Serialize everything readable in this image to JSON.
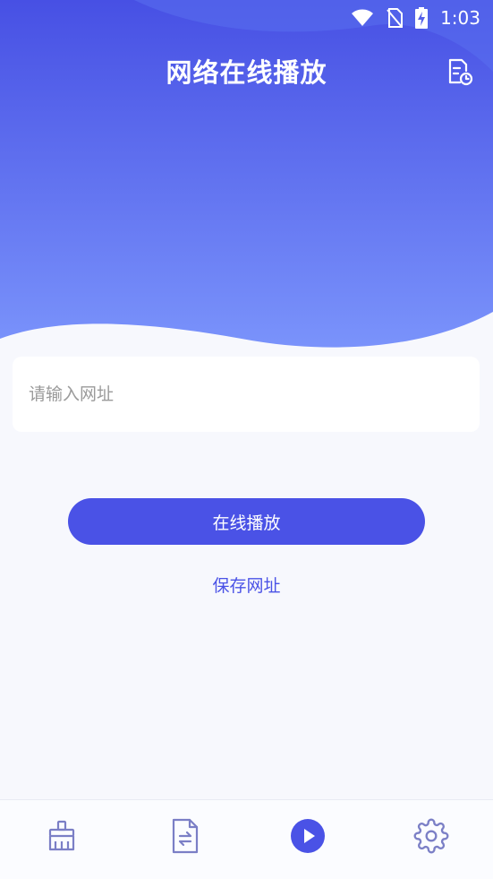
{
  "status_bar": {
    "time": "1:03"
  },
  "header": {
    "title": "网络在线播放",
    "history_icon": "history-document-icon"
  },
  "form": {
    "url_placeholder": "请输入网址",
    "url_value": "",
    "play_label": "在线播放",
    "save_label": "保存网址"
  },
  "bottom_nav": {
    "items": [
      {
        "id": "clean",
        "icon": "broom-icon",
        "active": false
      },
      {
        "id": "files",
        "icon": "document-transfer-icon",
        "active": false
      },
      {
        "id": "play",
        "icon": "play-circle-icon",
        "active": true
      },
      {
        "id": "settings",
        "icon": "gear-icon",
        "active": false
      }
    ]
  },
  "colors": {
    "accent": "#4a52e6",
    "gradient_top": "#4750e4",
    "gradient_bottom": "#7a93fb",
    "background": "#f7f8fd",
    "nav_icon": "#7b7fc6"
  }
}
